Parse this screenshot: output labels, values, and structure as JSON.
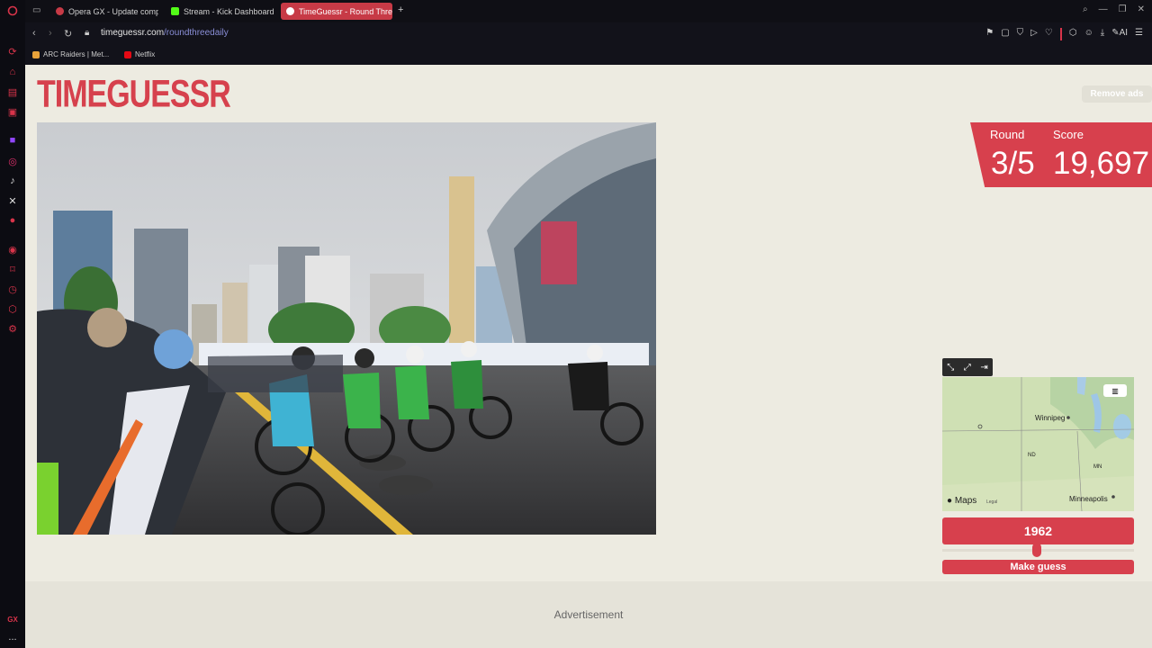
{
  "sidebar": {
    "icons": [
      "opera-logo-icon",
      "speed-dial-icon",
      "gx-corner-icon",
      "messenger-icon",
      "gx-control-icon",
      "twitch-icon",
      "instagram-icon",
      "tiktok-icon",
      "x-icon",
      "music-icon",
      "player-icon",
      "pinboard-icon",
      "history-icon",
      "extensions-icon",
      "settings-icon"
    ],
    "gx_label": "GX",
    "more": "..."
  },
  "tabs": [
    {
      "label": "Opera GX - Update compl",
      "favicon_color": "#c73a46"
    },
    {
      "label": "Stream - Kick Dashboard",
      "favicon_color": "#53fc18"
    },
    {
      "label": "TimeGuessr - Round Thre",
      "favicon_color": "#ffffff",
      "active": true
    }
  ],
  "new_tab": "+",
  "address": {
    "domain": "timeguessr.com",
    "path": "/roundthreedaily"
  },
  "bookmarks": [
    {
      "label": "ARC Raiders | Met...",
      "color": "#e8a23a"
    },
    {
      "label": "Netflix",
      "color": "#e50914"
    }
  ],
  "page": {
    "logo": "TIMEGUESSR",
    "remove_ads": "Remove ads",
    "round_label": "Round",
    "round_value": "3/5",
    "score_label": "Score",
    "score_value": "19,697",
    "map": {
      "labels": [
        "Winnipeg",
        "ND",
        "MN",
        "Minneapolis"
      ],
      "attribution": "Maps",
      "legal": "Legal"
    },
    "year": "1962",
    "slider_fraction": 0.5,
    "make_guess": "Make guess",
    "advertisement": "Advertisement"
  },
  "colors": {
    "accent": "#d7404d",
    "page_bg": "#edebe1"
  }
}
